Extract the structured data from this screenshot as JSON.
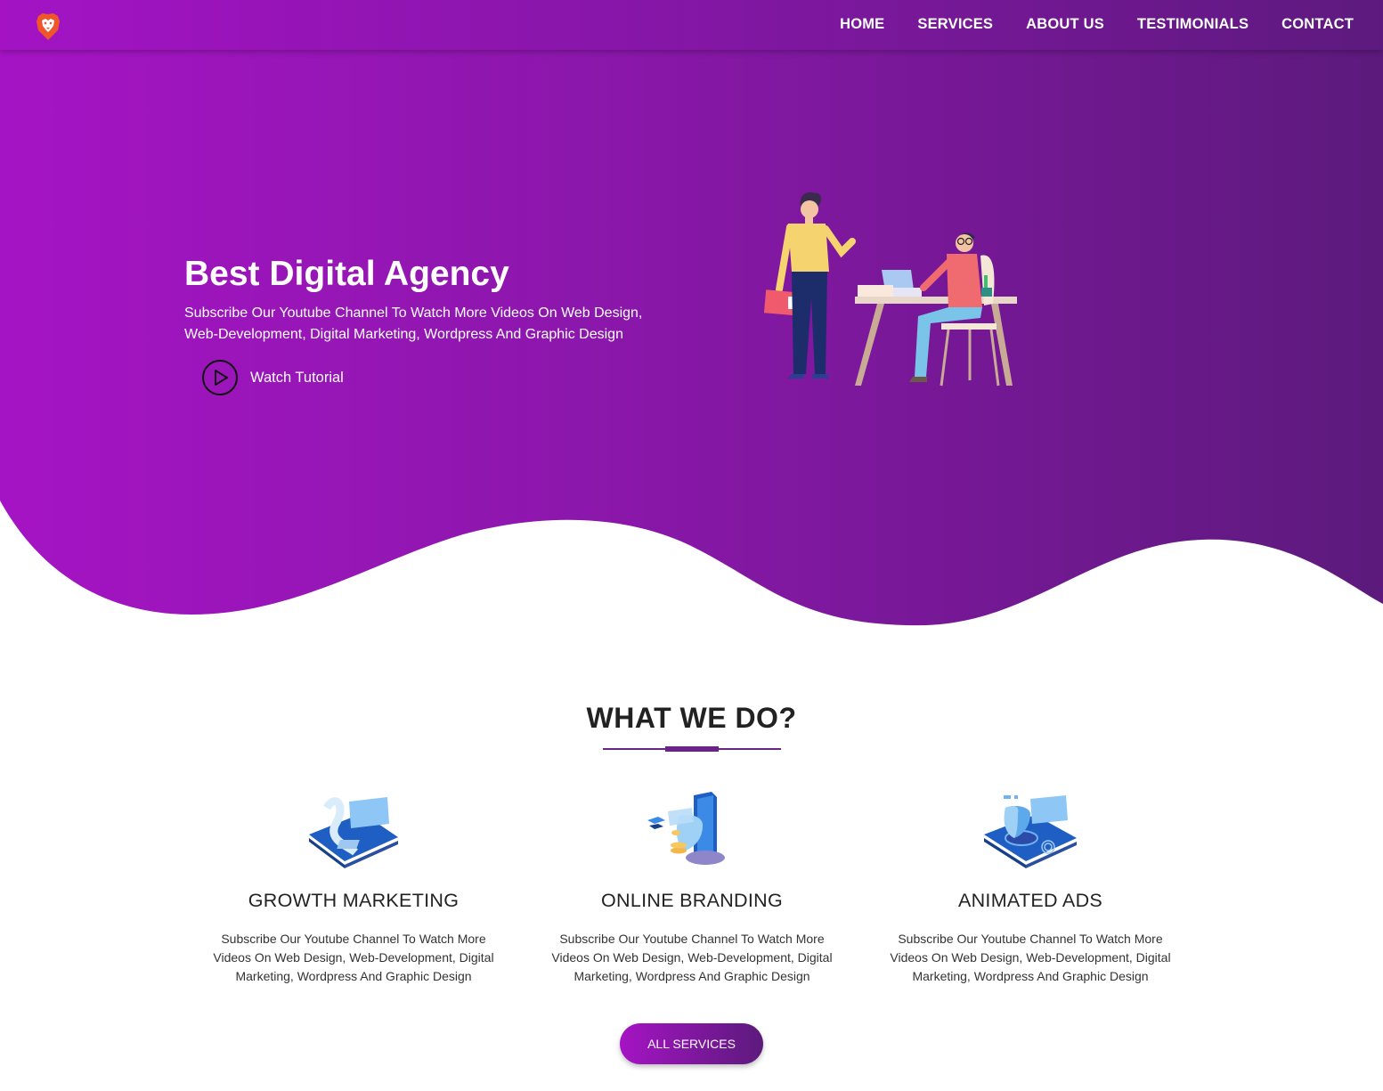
{
  "nav": {
    "logo_icon": "lion-shield-logo",
    "links": [
      "HOME",
      "SERVICES",
      "ABOUT US",
      "TESTIMONIALS",
      "CONTACT"
    ]
  },
  "hero": {
    "title": "Best Digital Agency",
    "subtitle": "Subscribe Our Youtube Channel To Watch More Videos On Web Design, Web-Development, Digital Marketing, Wordpress And Graphic Design",
    "watch_label": "Watch Tutorial",
    "illustration": "two-people-office-illustration"
  },
  "services_section": {
    "title": "WHAT WE DO?",
    "items": [
      {
        "icon": "payment-card-phone-icon",
        "title": "GROWTH MARKETING",
        "text": "Subscribe Our Youtube Channel To Watch More Videos On Web Design, Web-Development, Digital Marketing, Wordpress And Graphic Design"
      },
      {
        "icon": "secure-coins-icon",
        "title": "ONLINE BRANDING",
        "text": "Subscribe Our Youtube Channel To Watch More Videos On Web Design, Web-Development, Digital Marketing, Wordpress And Graphic Design"
      },
      {
        "icon": "shield-fingerprint-icon",
        "title": "ANIMATED ADS",
        "text": "Subscribe Our Youtube Channel To Watch More Videos On Web Design, Web-Development, Digital Marketing, Wordpress And Graphic Design"
      }
    ],
    "button_label": "ALL SERVICES"
  },
  "colors": {
    "gradient_start": "#a514c4",
    "gradient_end": "#5c1a7c",
    "accent": "#6a2386"
  }
}
